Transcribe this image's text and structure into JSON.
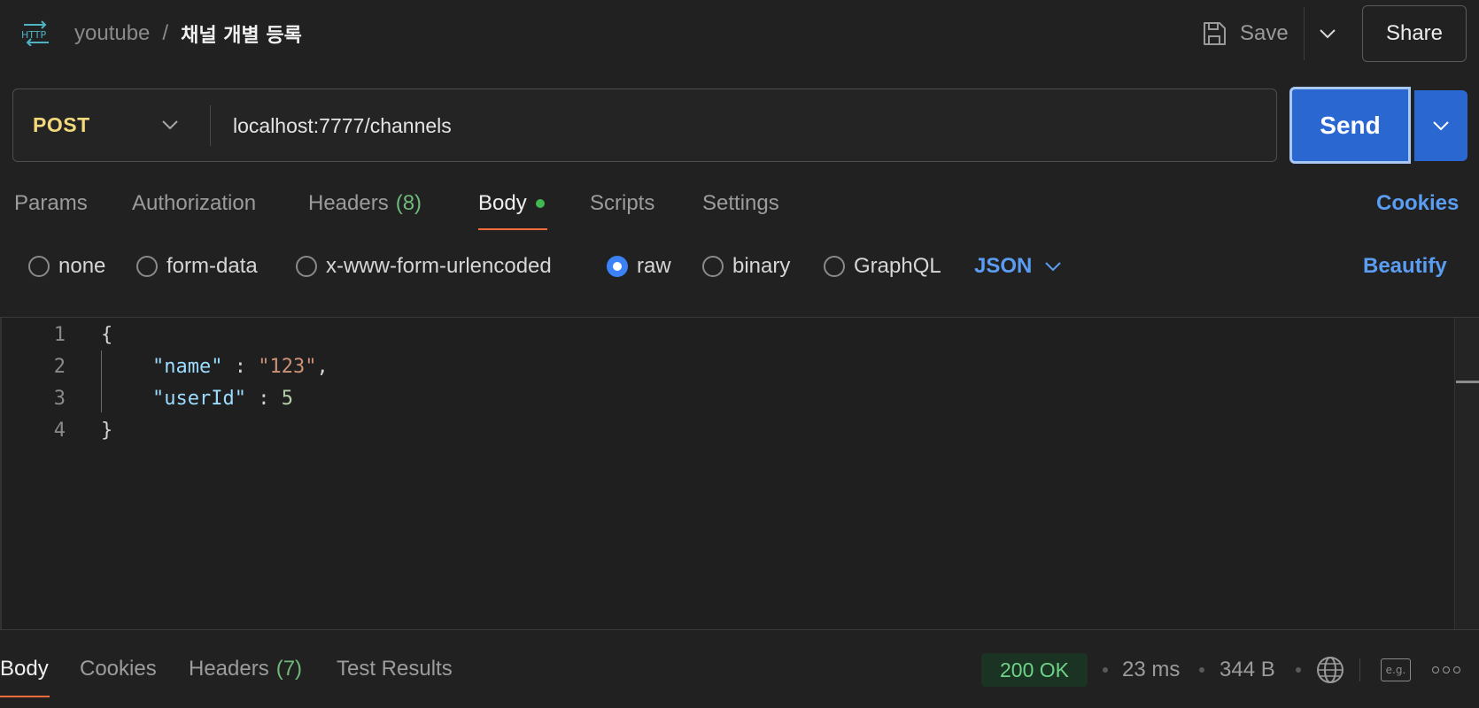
{
  "header": {
    "collection": "youtube",
    "separator": "/",
    "request_name": "채널 개별 등록",
    "save_label": "Save",
    "share_label": "Share"
  },
  "request": {
    "method": "POST",
    "url": "localhost:7777/channels",
    "send_label": "Send"
  },
  "tabs": {
    "params": "Params",
    "authorization": "Authorization",
    "headers": "Headers",
    "headers_count": "(8)",
    "body": "Body",
    "scripts": "Scripts",
    "settings": "Settings",
    "cookies": "Cookies"
  },
  "body_types": {
    "none": "none",
    "form_data": "form-data",
    "urlencoded": "x-www-form-urlencoded",
    "raw": "raw",
    "binary": "binary",
    "graphql": "GraphQL",
    "selected": "raw",
    "format": "JSON",
    "beautify": "Beautify"
  },
  "editor": {
    "line_numbers": [
      "1",
      "2",
      "3",
      "4"
    ],
    "open_brace": "{",
    "close_brace": "}",
    "field1_key": "\"name\"",
    "field1_colon": " : ",
    "field1_value": "\"123\"",
    "field1_comma": ",",
    "field2_key": "\"userId\"",
    "field2_colon": " : ",
    "field2_value": "5"
  },
  "response": {
    "tabs": {
      "body": "Body",
      "cookies": "Cookies",
      "headers": "Headers",
      "headers_count": "(7)",
      "test_results": "Test Results"
    },
    "status": "200 OK",
    "time": "23 ms",
    "size": "344 B",
    "example_icon_text": "e.g."
  },
  "colors": {
    "method": "#f1d97c",
    "accent_blue": "#2b67d1",
    "link_blue": "#5a9df2",
    "tab_underline": "#f26b3a",
    "status_green": "#6fd387",
    "dirty_dot": "#3fb950"
  },
  "icons": {
    "protocol": "http-icon",
    "save": "floppy-disk-icon",
    "dropdown": "chevron-down-icon",
    "network": "globe-icon",
    "example": "example-icon",
    "more": "more-options-icon"
  }
}
